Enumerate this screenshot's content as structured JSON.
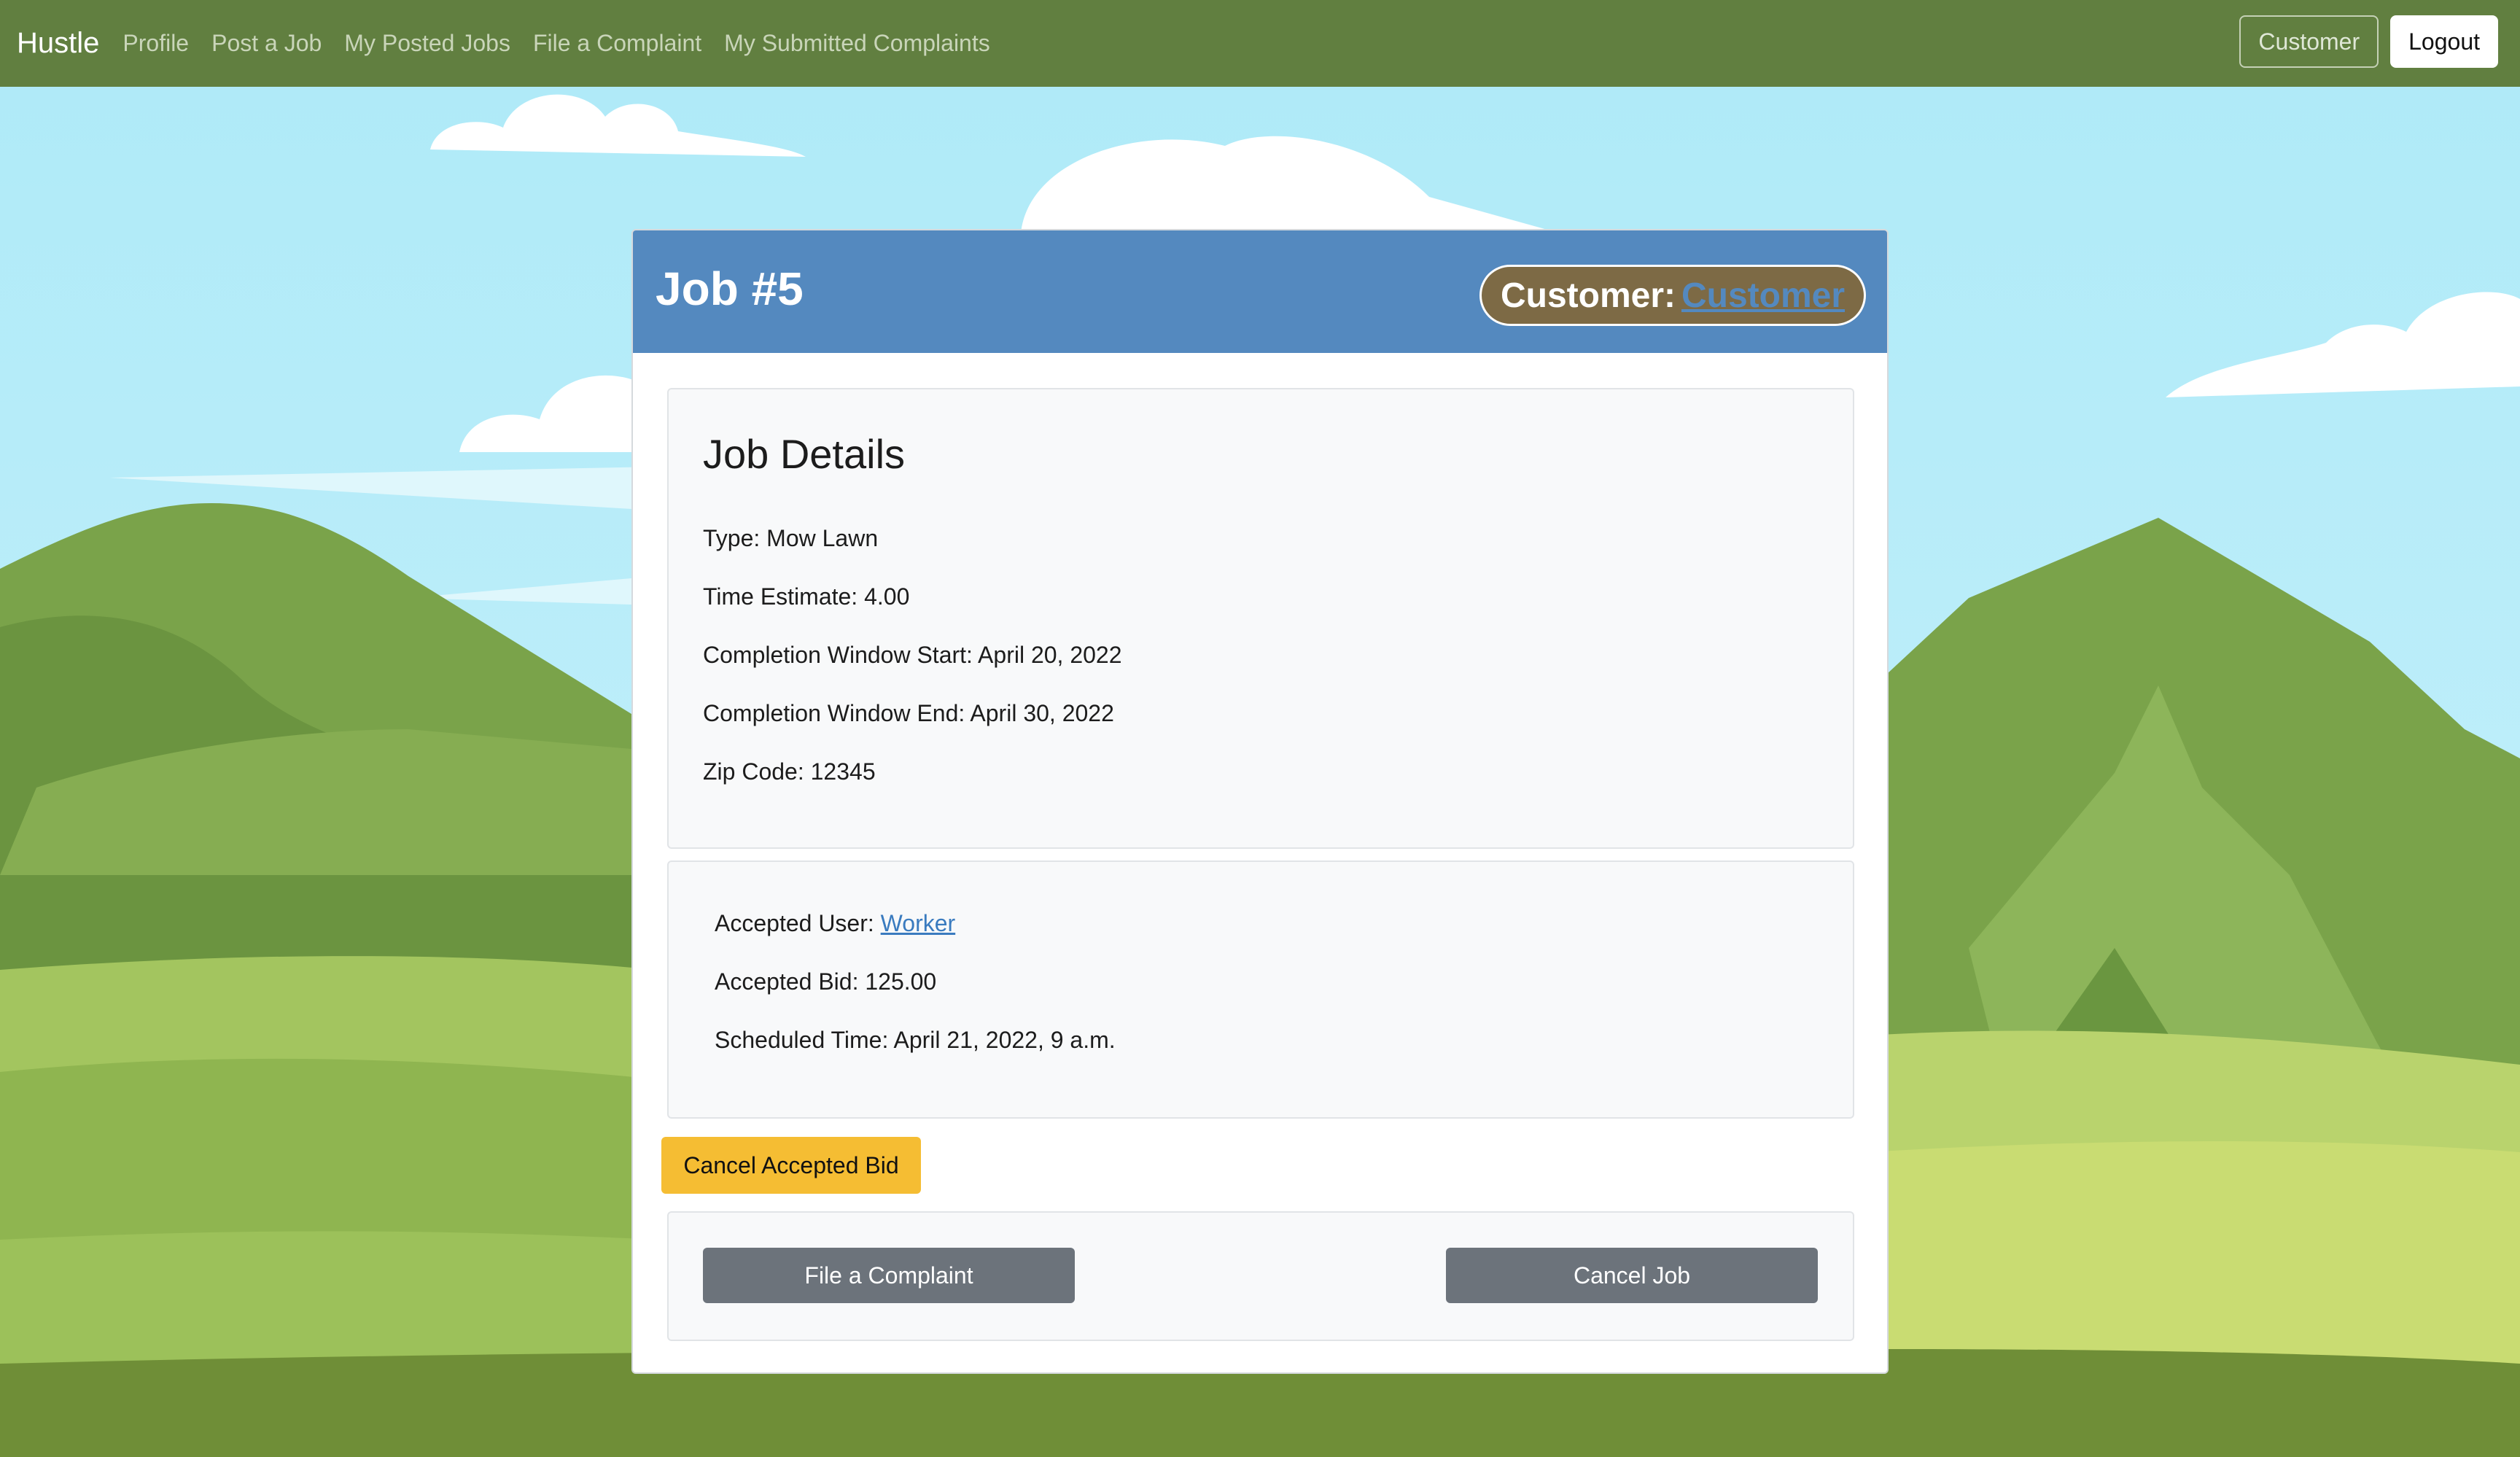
{
  "navbar": {
    "brand": "Hustle",
    "links": [
      "Profile",
      "Post a Job",
      "My Posted Jobs",
      "File a Complaint",
      "My Submitted Complaints"
    ],
    "role_button": "Customer",
    "logout_button": "Logout"
  },
  "job": {
    "title": "Job #5",
    "customer_label": "Customer:",
    "customer_link": "Customer"
  },
  "details": {
    "heading": "Job Details",
    "type": "Type: Mow Lawn",
    "time_estimate": "Time Estimate: 4.00",
    "window_start": "Completion Window Start: April 20, 2022",
    "window_end": "Completion Window End: April 30, 2022",
    "zip": "Zip Code: 12345"
  },
  "accepted": {
    "user_label": "Accepted User:",
    "user_link": "Worker",
    "bid": "Accepted Bid: 125.00",
    "scheduled": "Scheduled Time: April 21, 2022, 9 a.m."
  },
  "actions": {
    "cancel_bid": "Cancel Accepted Bid",
    "file_complaint": "File a Complaint",
    "cancel_job": "Cancel Job"
  },
  "colors": {
    "navbar": "#617f40",
    "card_header": "#5489bf",
    "customer_pill": "#7d6a45",
    "warning_button": "#f5bd33",
    "secondary_button": "#6c737b",
    "link": "#3a7bbf"
  }
}
